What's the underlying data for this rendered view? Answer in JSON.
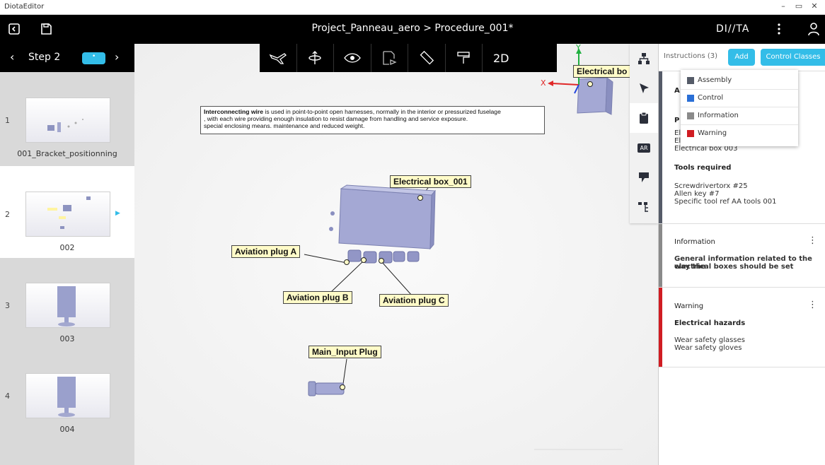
{
  "window": {
    "app_name": "DiotaEditor",
    "controls": [
      "–",
      "▭",
      "✕"
    ]
  },
  "header": {
    "title": "Project_Panneau_aero > Procedure_001*",
    "logo": "DI//TA"
  },
  "stepbar": {
    "label": "Step 2",
    "pill": "•"
  },
  "steps": [
    {
      "num": "1",
      "caption": "001_Bracket_positionning"
    },
    {
      "num": "2",
      "caption": "002"
    },
    {
      "num": "3",
      "caption": "003"
    },
    {
      "num": "4",
      "caption": "004"
    }
  ],
  "toolbar": {
    "view_2d": "2D"
  },
  "note": {
    "bold": "Interconnecting wire",
    "line1": " is used in point-to-point open harnesses, normally in the interior or pressurized fuselage",
    "line2": ", with each wire providing enough insulation to resist damage from handling and service exposure.",
    "line3": "special enclosing means. maintenance and reduced weight."
  },
  "labels": {
    "electrical_box_top": "Electrical bo",
    "electrical_box_001": "Electrical box_001",
    "plug_a": "Aviation plug A",
    "plug_b": "Aviation plug B",
    "plug_c": "Aviation plug C",
    "main_input": "Main_Input Plug",
    "axis_x": "X",
    "axis_y": "Y"
  },
  "panel": {
    "instructions": "Instructions (3)",
    "add": "Add",
    "control_classes": "Control Classes",
    "card1": {
      "partial_a": "A",
      "partial_p": "P",
      "partial_e1": "El",
      "partial_e2": "El",
      "item": "Electrical box 003",
      "tools_title": "Tools required",
      "tool1": "Screwdrivertorx #25",
      "tool2": "Allen key #7",
      "tool3": "Specific tool ref AA tools 001"
    },
    "card2": {
      "title": "Information",
      "line1": "General information related to the way the",
      "line2": "electrical boxes should be set"
    },
    "card3": {
      "title": "Warning",
      "subtitle": "Electrical hazards",
      "line1": "Wear safety glasses",
      "line2": "Wear safety gloves"
    }
  },
  "dropdown": [
    {
      "label": "Assembly",
      "color": "#555b68"
    },
    {
      "label": "Control",
      "color": "#2a6fd6"
    },
    {
      "label": "Information",
      "color": "#8a8a8a"
    },
    {
      "label": "Warning",
      "color": "#d01c22"
    }
  ],
  "colors": {
    "accent": "#33bde8",
    "warning": "#d01c22",
    "information": "#8a8a8a"
  }
}
